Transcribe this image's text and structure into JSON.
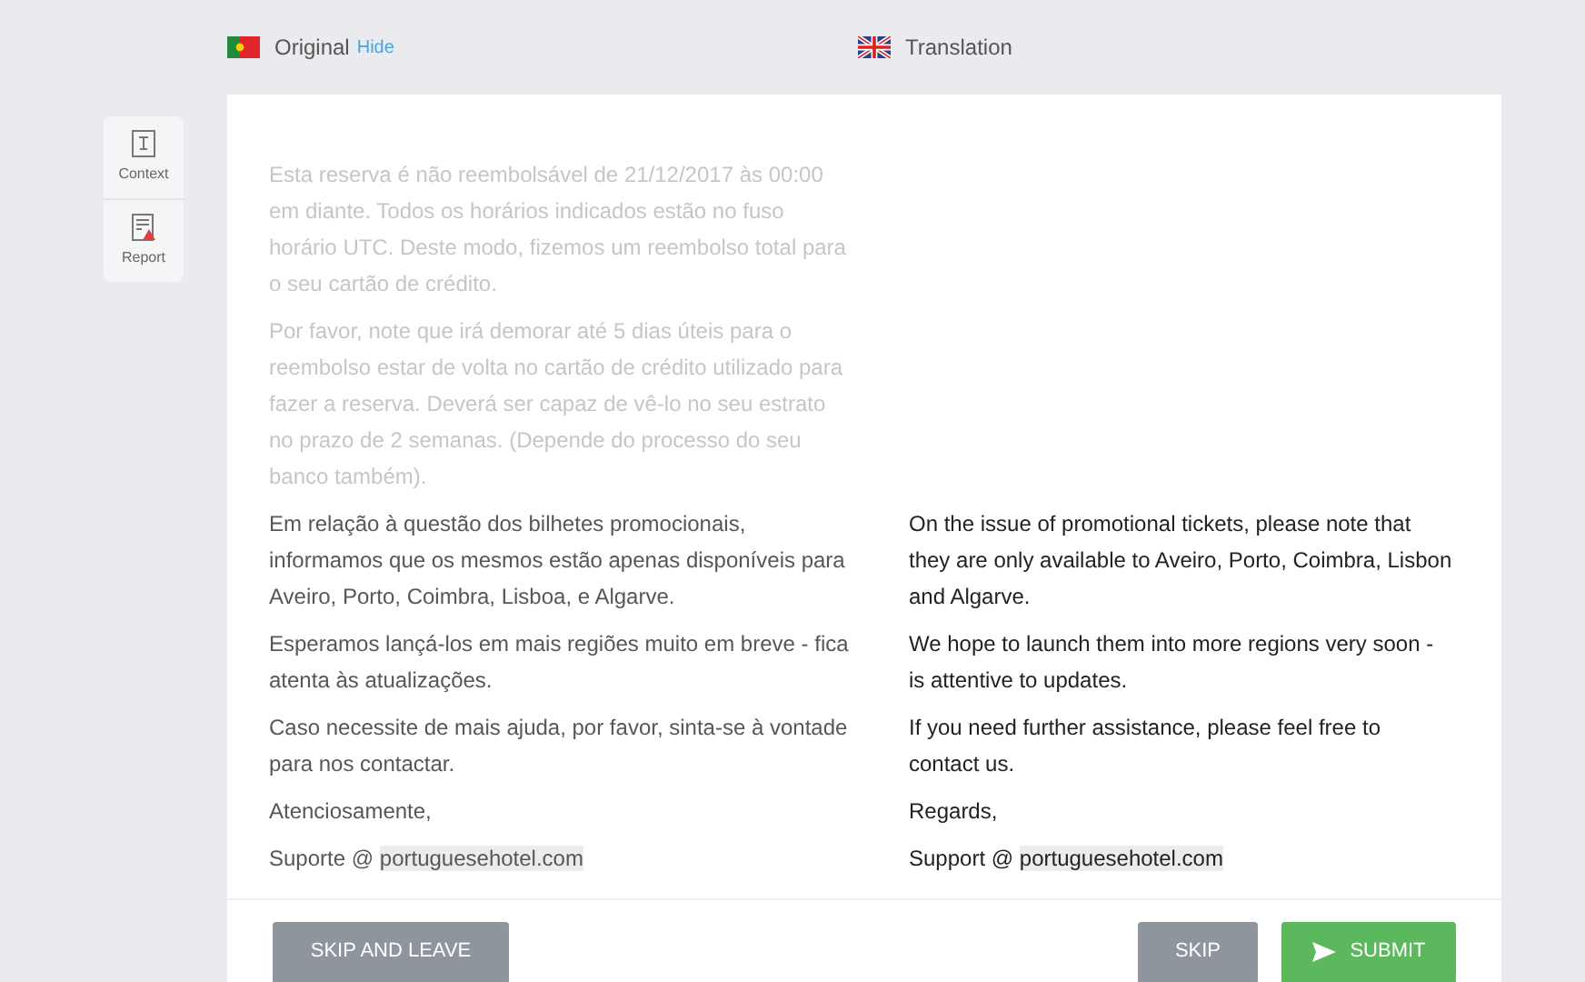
{
  "header": {
    "original_label": "Original",
    "hide_link": "Hide",
    "translation_label": "Translation"
  },
  "sidebar": [
    {
      "kind": "context",
      "label": "Context"
    },
    {
      "kind": "report",
      "label": "Report"
    }
  ],
  "paragraphs": [
    {
      "kind": "text",
      "faded": true,
      "original": "Esta reserva é não reembolsável de 21/12/2017 às 00:00 em diante. Todos os horários indicados estão no fuso horário UTC. Deste modo, fizemos um reembolso total para o seu cartão de crédito."
    },
    {
      "kind": "text",
      "faded": true,
      "original": "Por favor, note que irá demorar até 5 dias úteis para o reembolso estar de volta no cartão de crédito utilizado para fazer a reserva. Deverá ser capaz de vê-lo no seu estrato no prazo de 2 semanas. (Depende do processo do seu banco também)."
    },
    {
      "kind": "text",
      "faded": false,
      "original": "Em relação à questão dos bilhetes promocionais, informamos que os mesmos estão apenas disponíveis para Aveiro, Porto, Coimbra, Lisboa, e Algarve.",
      "translation": "On the issue of promotional tickets, please note that they are only available to Aveiro, Porto, Coimbra, Lisbon and Algarve."
    },
    {
      "kind": "text",
      "faded": false,
      "original": "Esperamos lançá-los em mais regiões muito em breve - fica atenta às atualizações.",
      "translation": "We hope to launch them into more regions very soon - is attentive to updates."
    },
    {
      "kind": "text",
      "faded": false,
      "original": "Caso necessite de mais ajuda, por favor, sinta-se à vontade para nos contactar.",
      "translation": "If you need further assistance, please feel free to contact us."
    },
    {
      "kind": "text",
      "faded": false,
      "original": "Atenciosamente,",
      "translation": "Regards,"
    },
    {
      "kind": "signature",
      "faded": false,
      "original": "Suporte @",
      "original_domain": "portuguesehotel.com",
      "translation": "Support @",
      "translation_domain": "portuguesehotel.com"
    }
  ],
  "buttons": [
    {
      "kind": "leave",
      "label": "SKIP AND LEAVE"
    },
    {
      "kind": "skip",
      "label": "SKIP"
    },
    {
      "kind": "submit",
      "label": "SUBMIT"
    }
  ]
}
